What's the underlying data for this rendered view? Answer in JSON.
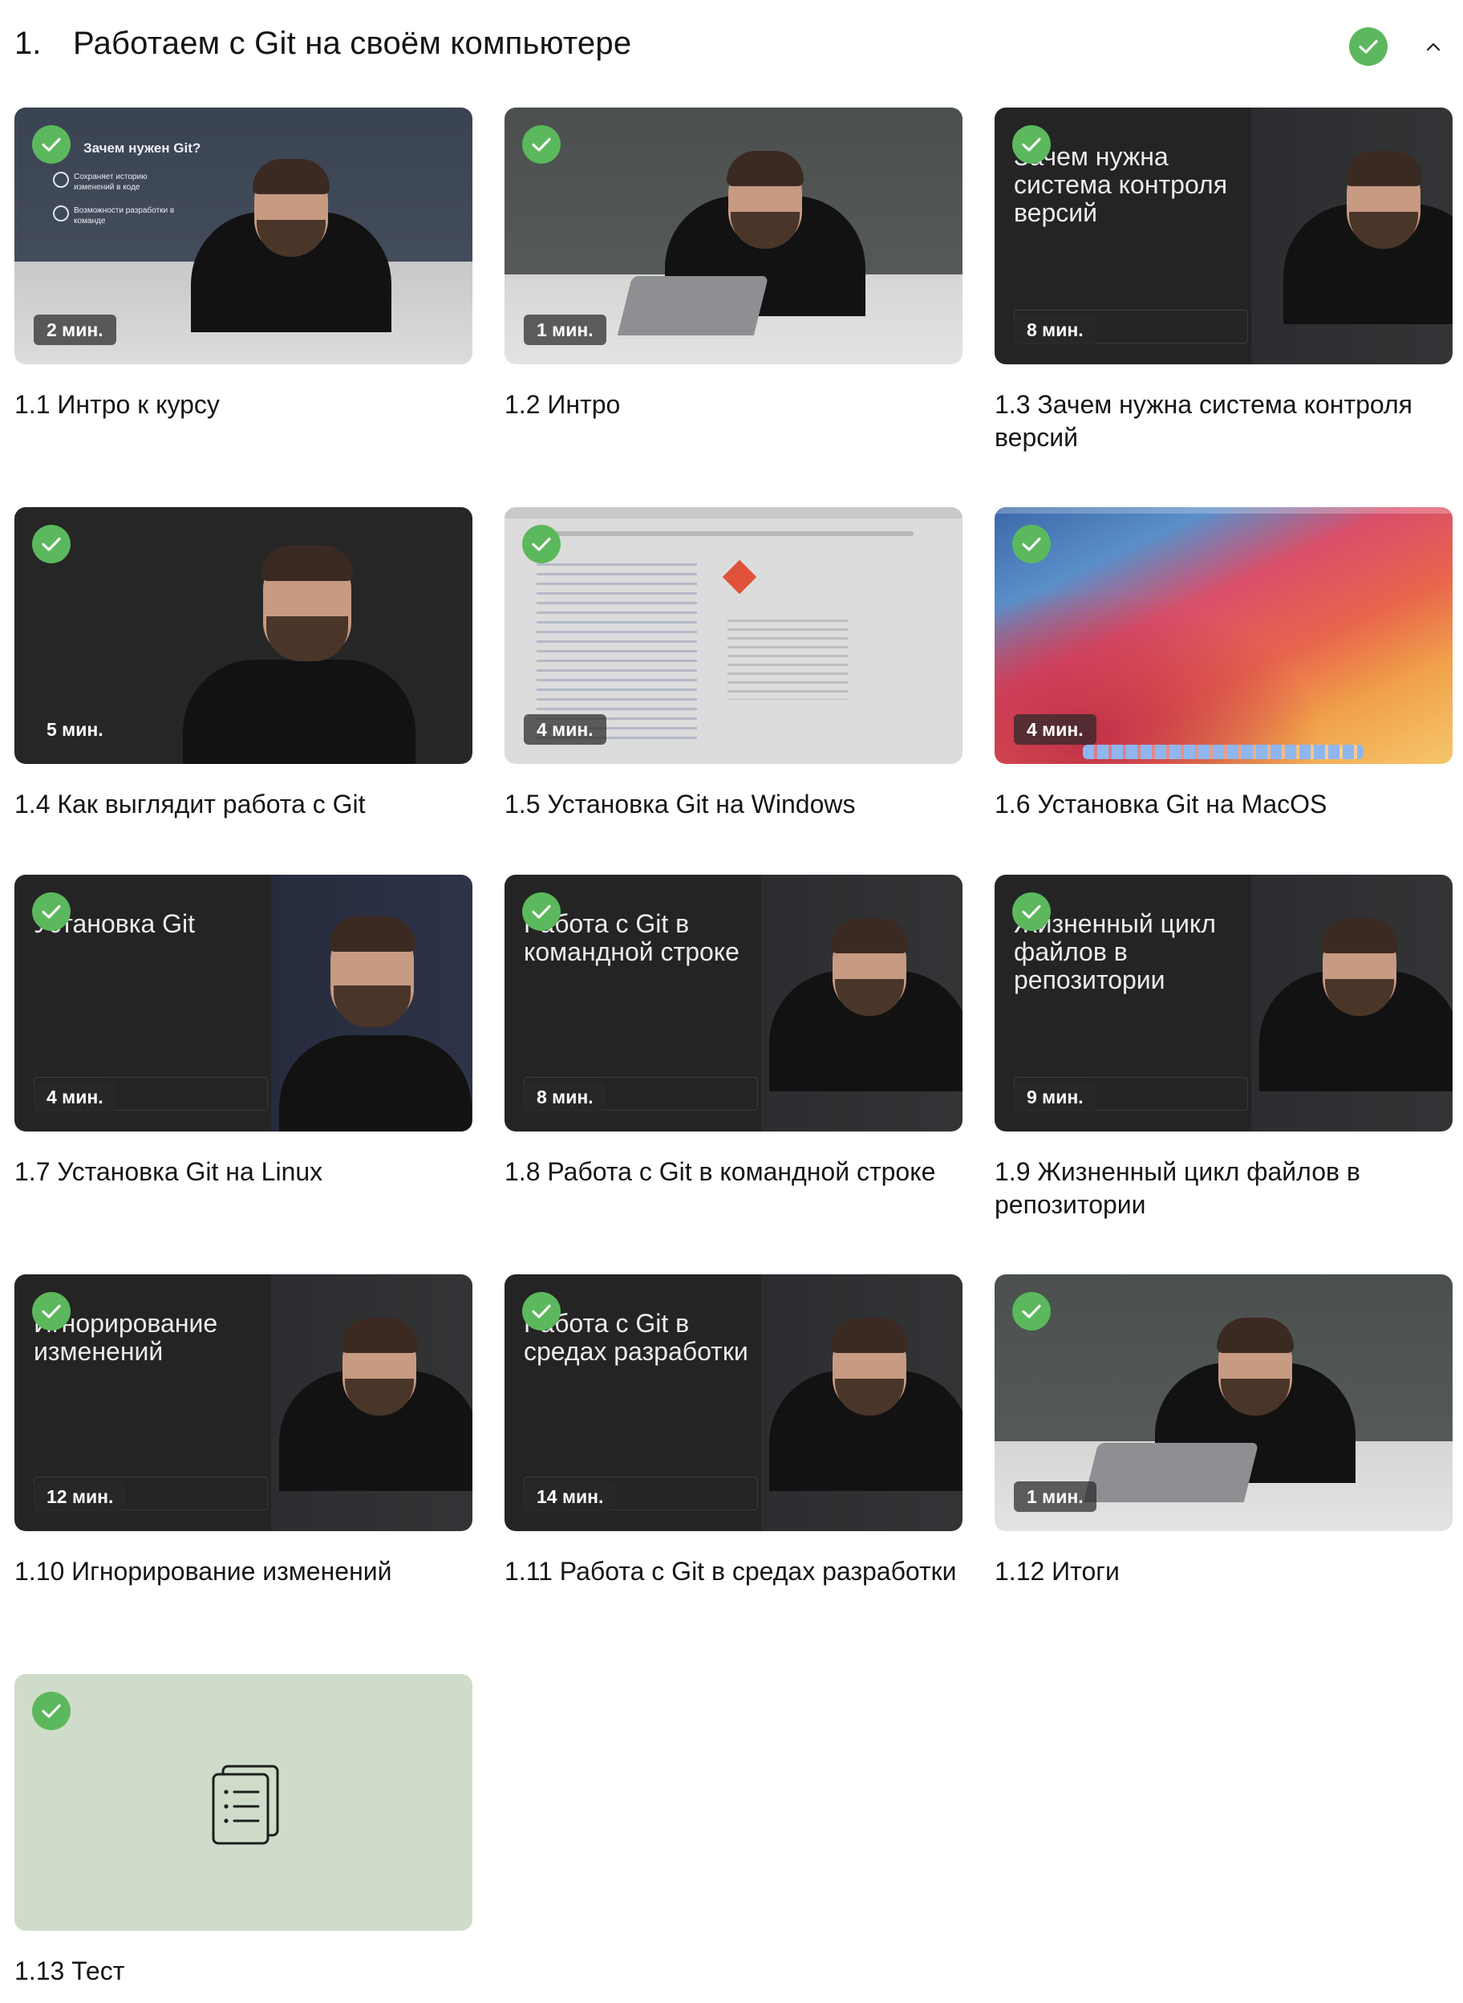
{
  "module": {
    "number": "1.",
    "title": "Работаем с Git на своём компьютере",
    "completed": true,
    "expanded": true
  },
  "colors": {
    "check_green": "#5cb85c",
    "test_bg": "#cfdcc9",
    "text": "#151515"
  },
  "lessons": [
    {
      "label": "1.1 Интро к курсу",
      "duration": "2 мин.",
      "completed": true,
      "thumb": "navy-presenter",
      "slide": {
        "title": "Зачем нужен Git?",
        "bullets": [
          "Сохраняет историю изменений в коде",
          "Возможности разработки в команде"
        ]
      }
    },
    {
      "label": "1.2 Интро",
      "duration": "1 мин.",
      "completed": true,
      "thumb": "presenter-laptop"
    },
    {
      "label": "1.3 Зачем нужна система контроля версий",
      "duration": "8 мин.",
      "completed": true,
      "thumb": "split-slide",
      "slide": {
        "title": "Зачем нужна система контроля версий"
      }
    },
    {
      "label": "1.4 Как выглядит работа с Git",
      "duration": "5 мин.",
      "completed": true,
      "thumb": "dark-presenter"
    },
    {
      "label": "1.5 Установка Git на Windows",
      "duration": "4 мин.",
      "completed": true,
      "thumb": "browser-screen"
    },
    {
      "label": "1.6 Установка Git на MacOS",
      "duration": "4 мин.",
      "completed": true,
      "thumb": "macos-desktop"
    },
    {
      "label": "1.7 Установка Git на Linux",
      "duration": "4 мин.",
      "completed": true,
      "thumb": "split-slide",
      "slide": {
        "title": "Установка Git"
      }
    },
    {
      "label": "1.8 Работа с Git в командной строке",
      "duration": "8 мин.",
      "completed": true,
      "thumb": "split-slide",
      "slide": {
        "title": "Работа с Git в командной строке"
      }
    },
    {
      "label": "1.9 Жизненный цикл файлов в репозитории",
      "duration": "9 мин.",
      "completed": true,
      "thumb": "split-slide",
      "slide": {
        "title": "Жизненный цикл файлов в репозитории"
      }
    },
    {
      "label": "1.10 Игнорирование изменений",
      "duration": "12 мин.",
      "completed": true,
      "thumb": "split-slide",
      "slide": {
        "title": "Игнорирование изменений"
      }
    },
    {
      "label": "1.11 Работа с Git в средах разработки",
      "duration": "14 мин.",
      "completed": true,
      "thumb": "split-slide",
      "slide": {
        "title": "Работа с Git в средах разработки"
      }
    },
    {
      "label": "1.12 Итоги",
      "duration": "1 мин.",
      "completed": true,
      "thumb": "presenter-laptop"
    },
    {
      "label": "1.13 Тест",
      "completed": true,
      "thumb": "test",
      "icon": "document-list-icon"
    }
  ]
}
